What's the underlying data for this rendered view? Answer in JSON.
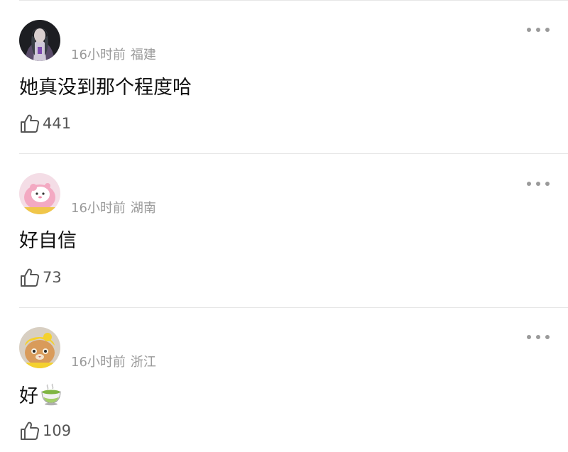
{
  "comments": [
    {
      "time": "16小时前",
      "location": "福建",
      "text": "她真没到那个程度哈",
      "likes": "441",
      "avatar_icon": "dark-hair-character-avatar"
    },
    {
      "time": "16小时前",
      "location": "湖南",
      "text": "好自信",
      "likes": "73",
      "avatar_icon": "pink-cartoon-avatar"
    },
    {
      "time": "16小时前",
      "location": "浙江",
      "text": "好",
      "emoji": "tea-emoji",
      "likes": "109",
      "avatar_icon": "cat-with-yellow-hat-avatar"
    }
  ],
  "colors": {
    "meta_text": "#9a9a9a",
    "body_text": "#111111",
    "divider": "#e6e6e6"
  }
}
